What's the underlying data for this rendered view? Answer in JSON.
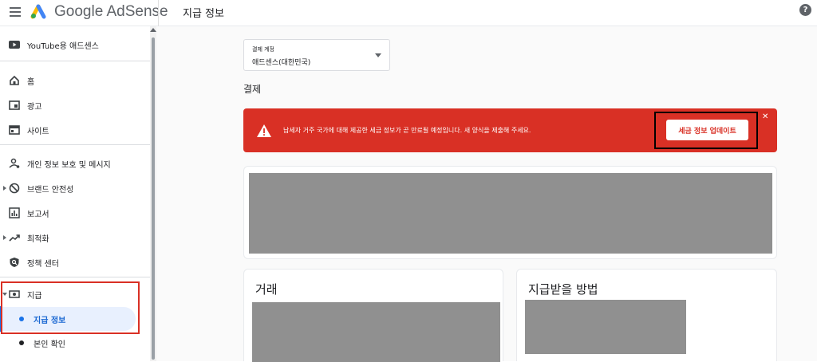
{
  "header": {
    "app_name": "Google AdSense",
    "page_title": "지급 정보",
    "help_glyph": "?"
  },
  "sidebar": {
    "items": [
      {
        "label": "YouTube용 애드센스",
        "icon": "youtube-icon"
      },
      {
        "label": "홈",
        "icon": "home-icon"
      },
      {
        "label": "광고",
        "icon": "ads-icon"
      },
      {
        "label": "사이트",
        "icon": "sites-icon"
      },
      {
        "label": "개인 정보 보호 및 메시지",
        "icon": "privacy-icon"
      },
      {
        "label": "브랜드 안전성",
        "icon": "block-icon"
      },
      {
        "label": "보고서",
        "icon": "reports-icon"
      },
      {
        "label": "최적화",
        "icon": "trending-icon"
      },
      {
        "label": "정책 센터",
        "icon": "policy-icon"
      },
      {
        "label": "지급",
        "icon": "payments-icon"
      }
    ],
    "sub_items": [
      {
        "label": "지급 정보",
        "active": true
      },
      {
        "label": "본인 확인",
        "active": false
      }
    ]
  },
  "main": {
    "account_select": {
      "label": "결제 계정",
      "value": "애드센스(대한민국)"
    },
    "section_title": "결제",
    "alert": {
      "message": "납세자 거주 국가에 대해 제공한 세금 정보가 곧 만료될 예정입니다. 새 양식을 제출해 주세요.",
      "button_label": "세금 정보 업데이트",
      "close_glyph": "✕",
      "color": "#d93025"
    },
    "cards": [
      {
        "title": "거래"
      },
      {
        "title": "지급받을 방법"
      }
    ]
  },
  "colors": {
    "accent": "#1a73e8",
    "alert": "#d93025",
    "placeholder": "#909090"
  }
}
